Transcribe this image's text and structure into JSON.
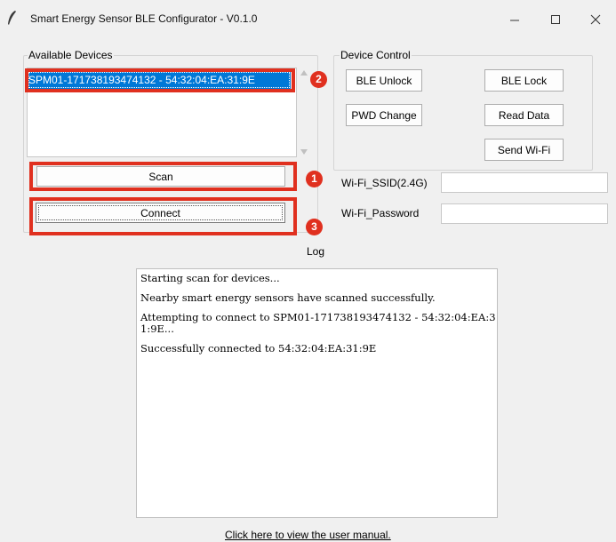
{
  "window": {
    "title": "Smart Energy Sensor BLE Configurator - V0.1.0",
    "app_icon": "feather-icon",
    "controls": [
      "minimize-icon",
      "maximize-icon",
      "close-icon"
    ]
  },
  "devices": {
    "group_label": "Available Devices",
    "items": [
      "SPM01-171738193474132 - 54:32:04:EA:31:9E"
    ],
    "selected_index": 0,
    "scan_label": "Scan",
    "connect_label": "Connect"
  },
  "annotations": {
    "color": "#e0301f",
    "badges": [
      "1",
      "2",
      "3"
    ]
  },
  "control": {
    "group_label": "Device Control",
    "ble_unlock": "BLE Unlock",
    "ble_lock": "BLE Lock",
    "pwd_change": "PWD Change",
    "read_data": "Read Data",
    "send_wifi": "Send Wi-Fi",
    "ssid_label": "Wi-Fi_SSID(2.4G)",
    "ssid_value": "",
    "password_label": "Wi-Fi_Password",
    "password_value": ""
  },
  "log": {
    "label": "Log",
    "lines": [
      "Starting scan for devices...",
      "Nearby smart energy sensors have scanned successfully.",
      "Attempting to connect to SPM01-171738193474132 - 54:32:04:EA:31:9E...",
      "Successfully connected to 54:32:04:EA:31:9E"
    ]
  },
  "footer": {
    "manual_link": "Click here to view the user manual."
  },
  "colors": {
    "selection": "#0078d7",
    "annotation": "#e0301f",
    "window_bg": "#f0f0f0"
  }
}
